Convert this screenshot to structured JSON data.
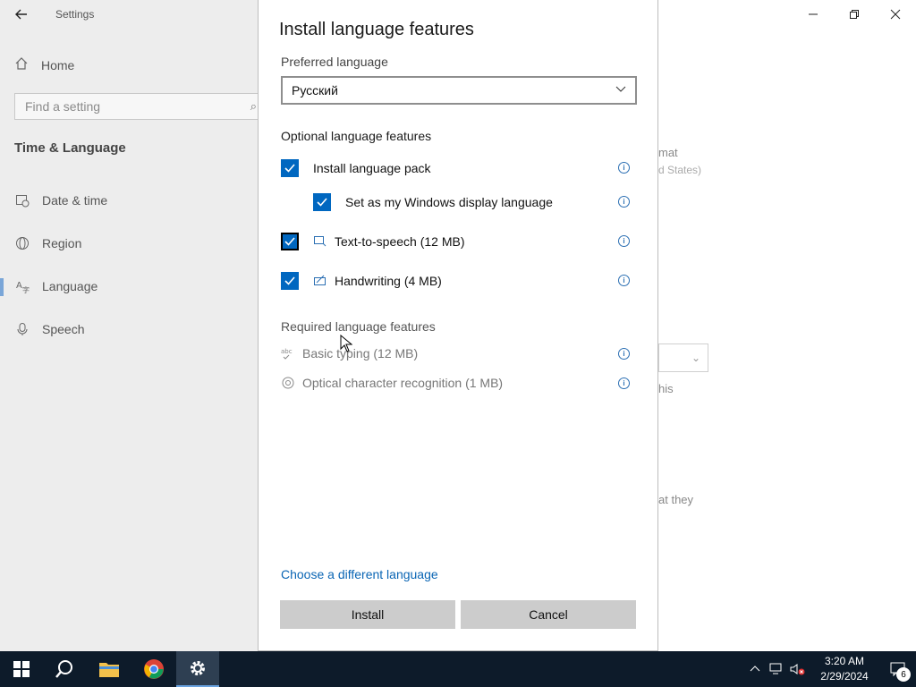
{
  "settings": {
    "app_title": "Settings",
    "home_label": "Home",
    "search_placeholder": "Find a setting",
    "section_title": "Time & Language",
    "nav": [
      {
        "label": "Date & time",
        "icon": "calendar-clock-icon"
      },
      {
        "label": "Region",
        "icon": "globe-icon"
      },
      {
        "label": "Language",
        "icon": "language-icon"
      },
      {
        "label": "Speech",
        "icon": "microphone-icon"
      }
    ],
    "bg_fragments": {
      "frag1": "mat",
      "frag2": "d States)",
      "frag3": "his",
      "frag4": "at they"
    }
  },
  "dialog": {
    "title": "Install language features",
    "preferred_label": "Preferred language",
    "selected_language": "Русский",
    "optional_heading": "Optional language features",
    "optional": [
      {
        "label": "Install language pack",
        "checked": true
      },
      {
        "label": "Set as my Windows display language",
        "checked": true
      },
      {
        "label": "Text-to-speech (12 MB)",
        "checked": true,
        "icon": "text-to-speech-icon"
      },
      {
        "label": "Handwriting (4 MB)",
        "checked": true,
        "icon": "handwriting-icon"
      }
    ],
    "required_heading": "Required language features",
    "required": [
      {
        "label": "Basic typing (12 MB)",
        "icon": "basic-typing-icon"
      },
      {
        "label": "Optical character recognition (1 MB)",
        "icon": "ocr-icon"
      }
    ],
    "link_text": "Choose a different language",
    "install_label": "Install",
    "cancel_label": "Cancel"
  },
  "taskbar": {
    "time": "3:20 AM",
    "date": "2/29/2024",
    "notification_count": "6"
  },
  "colors": {
    "accent": "#0067c0",
    "taskbar": "#0d1b2a",
    "link": "#0a65b4"
  }
}
